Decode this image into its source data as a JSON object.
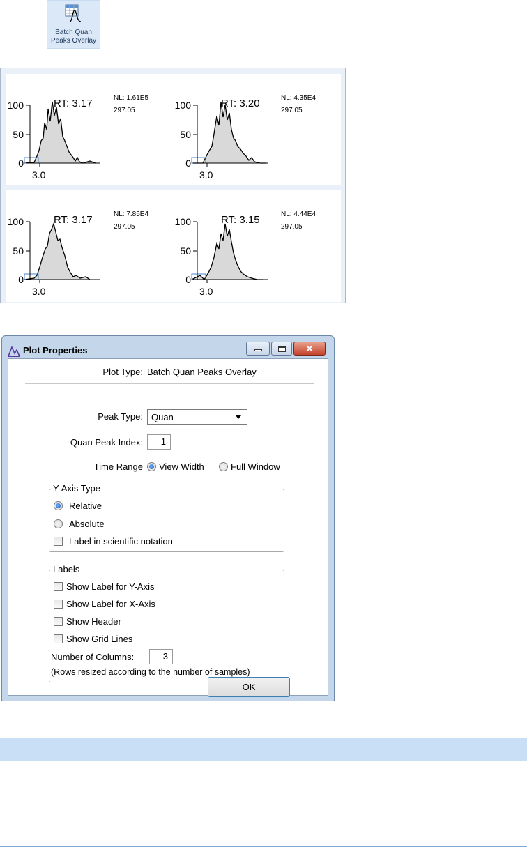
{
  "ribbon": {
    "label_line1": "Batch Quan",
    "label_line2": "Peaks Overlay"
  },
  "overlay": {
    "cells": [
      {
        "rt": "RT: 3.17",
        "nl": "NL: 1.61E5",
        "mz": "297.05"
      },
      {
        "rt": "RT: 3.20",
        "nl": "NL: 4.35E4",
        "mz": "297.05"
      },
      {
        "rt": "RT: 3.17",
        "nl": "NL: 7.85E4",
        "mz": "297.05"
      },
      {
        "rt": "RT: 3.15",
        "nl": "NL: 4.44E4",
        "mz": "297.05"
      }
    ],
    "y_ticks": [
      "100",
      "50",
      "0"
    ],
    "x_tick": "3.0"
  },
  "dialog": {
    "title": "Plot Properties",
    "plot_type_label": "Plot Type:",
    "plot_type_value": "Batch Quan Peaks Overlay",
    "peak_type_label": "Peak Type:",
    "peak_type_value": "Quan",
    "quan_peak_index_label": "Quan Peak Index:",
    "quan_peak_index_value": "1",
    "time_range_label": "Time Range",
    "time_range_options": [
      "View Width",
      "Full Window"
    ],
    "yaxis_group": "Y-Axis Type",
    "yaxis_relative": "Relative",
    "yaxis_absolute": "Absolute",
    "yaxis_scientific": "Label in scientific notation",
    "labels_group": "Labels",
    "show_label_y": "Show Label for Y-Axis",
    "show_label_x": "Show Label for X-Axis",
    "show_header": "Show Header",
    "show_grid": "Show Grid Lines",
    "num_columns_label": "Number of Columns:",
    "num_columns_value": "3",
    "rows_note": "(Rows resized according to the number of samples)",
    "ok": "OK"
  }
}
